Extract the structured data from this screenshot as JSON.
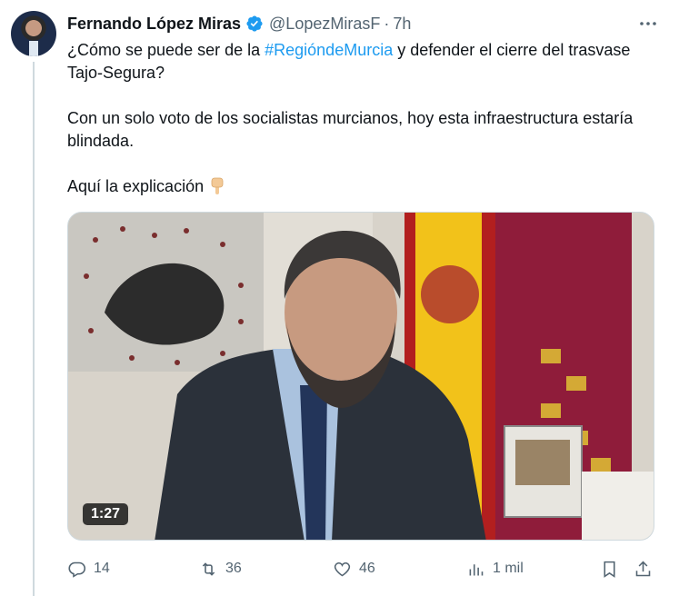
{
  "tweet": {
    "author_name": "Fernando López Miras",
    "handle": "@LopezMirasF",
    "separator": "·",
    "time": "7h",
    "text_part1": "¿Cómo se puede ser de la ",
    "hashtag": "#RegióndeMurcia",
    "text_part2": " y defender el cierre del trasvase Tajo-Segura?",
    "paragraph2": "Con un solo voto de los socialistas murcianos, hoy esta infraestructura estaría blindada.",
    "paragraph3": "Aquí la explicación",
    "emoji": "pointing-down-emoji"
  },
  "media": {
    "duration": "1:27"
  },
  "actions": {
    "replies": "14",
    "reposts": "36",
    "likes": "46",
    "views": "1 mil"
  },
  "colors": {
    "accent": "#1d9bf0",
    "muted": "#536471",
    "text": "#0f1419"
  }
}
